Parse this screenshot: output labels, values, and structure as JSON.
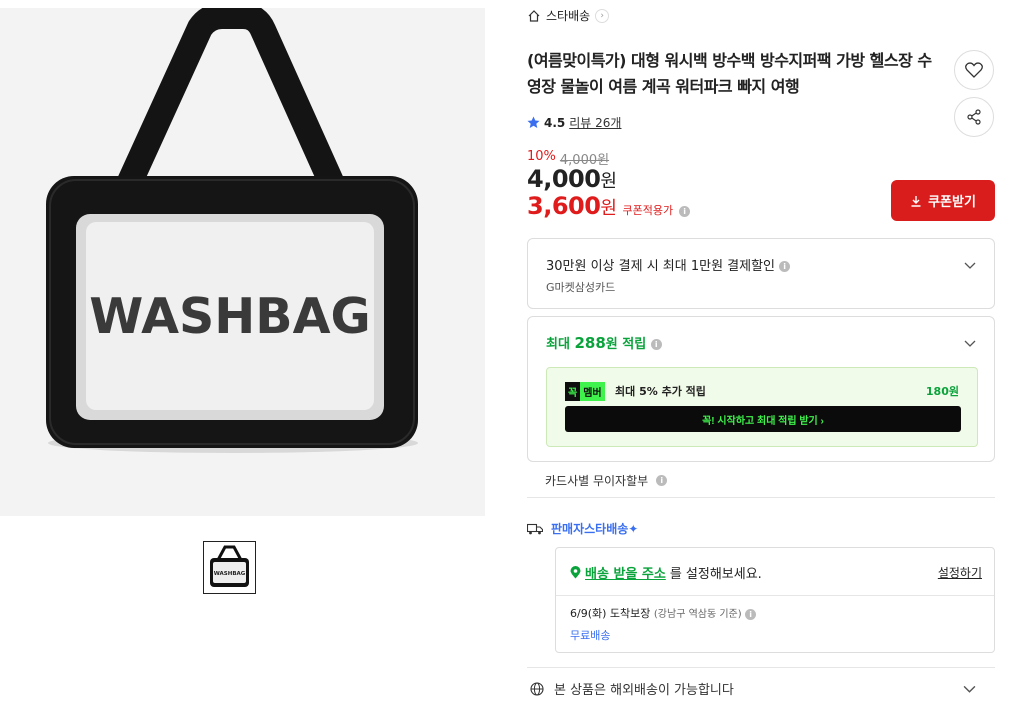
{
  "product": {
    "image_text": "WASHBAG",
    "thumb_text": "WASHBAG"
  },
  "breadcrumb": {
    "label": "스타배송"
  },
  "title": "(여름맞이특가) 대형 워시백 방수백 방수지퍼팩 가방 헬스장 수영장 물놀이 여름 계곡 워터파크 빠지 여행",
  "rating": {
    "score": "4.5",
    "review_label": "리뷰 26개"
  },
  "price": {
    "discount_rate": "10%",
    "original": "4,000원",
    "current_num": "4,000",
    "current_unit": "원",
    "coupon_num": "3,600",
    "coupon_unit": "원",
    "coupon_note": "쿠폰적용가"
  },
  "coupon_button": {
    "label": "쿠폰받기"
  },
  "card_benefit": {
    "line1": "30만원 이상 결제 시 최대 1만원 결제할인",
    "line2": "G마켓삼성카드"
  },
  "points": {
    "prefix": "최대",
    "amount": "288",
    "suffix": "원 적립",
    "member_tag_a": "꼭",
    "member_tag_b": "멤버",
    "member_desc": "최대 5% 추가 적립",
    "member_points": "180원",
    "cta": "꼭! 시작하고 최대 적립 받기 ›"
  },
  "installment": {
    "label": "카드사별 무이자할부"
  },
  "seller": {
    "label": "판매자스타배송✦"
  },
  "shipping": {
    "addr_link": "배송 받을 주소",
    "addr_rest": "를 설정해보세요.",
    "set_label": "설정하기",
    "eta": "6/9(화) 도착보장",
    "eta_note": "(강남구 역삼동 기준)",
    "fee": "무료배송"
  },
  "overseas": {
    "label": "본 상품은 해외배송이 가능합니다"
  },
  "colors": {
    "red": "#d91c1c",
    "green": "#0aa33b",
    "blue": "#3a6ff0",
    "member_green": "#3ff24c"
  }
}
